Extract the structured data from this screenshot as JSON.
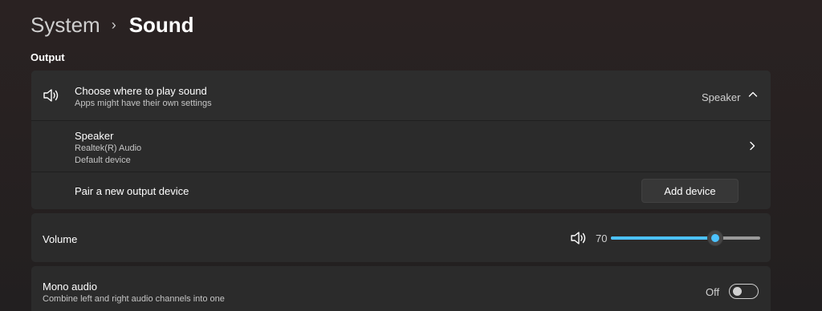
{
  "breadcrumb": {
    "parent": "System",
    "separator": "›",
    "current": "Sound"
  },
  "output": {
    "section_title": "Output",
    "choose": {
      "icon": "speaker-icon",
      "title": "Choose where to play sound",
      "subtitle": "Apps might have their own settings",
      "selected": "Speaker",
      "expand_icon": "chevron-up-icon"
    },
    "device": {
      "name": "Speaker",
      "driver": "Realtek(R) Audio",
      "status": "Default device",
      "nav_icon": "chevron-right-icon"
    },
    "pair": {
      "label": "Pair a new output device",
      "button": "Add device"
    }
  },
  "volume": {
    "label": "Volume",
    "icon": "speaker-icon",
    "value": 70,
    "value_text": "70",
    "accent": "#4cc2ff"
  },
  "mono": {
    "title": "Mono audio",
    "subtitle": "Combine left and right audio channels into one",
    "state_text": "Off",
    "on": false
  }
}
